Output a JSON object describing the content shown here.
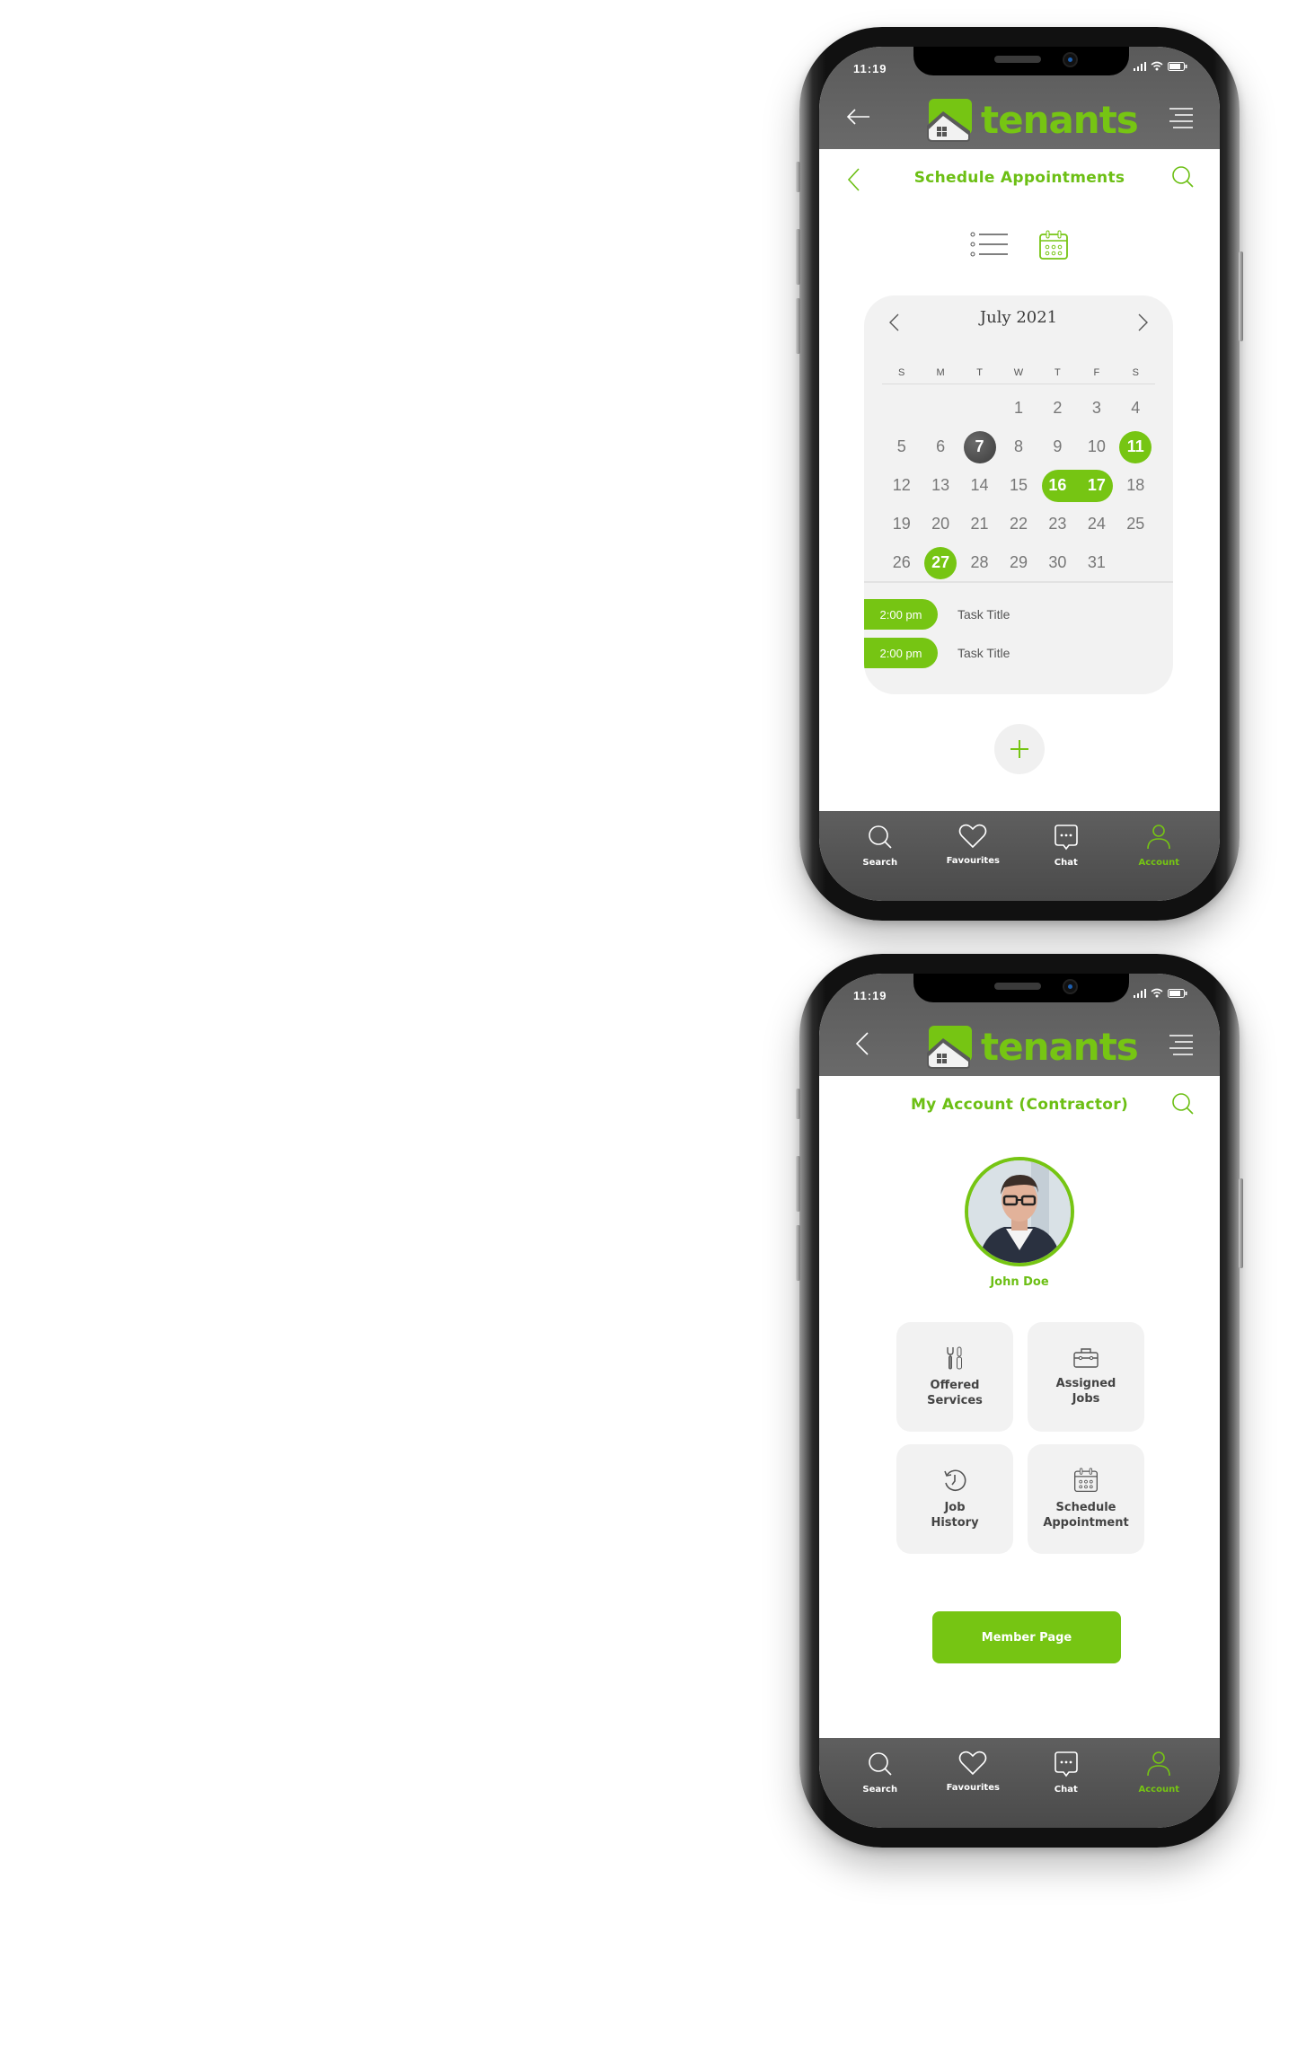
{
  "colors": {
    "accent": "#76c513",
    "header_bg": "#606060",
    "tabbar_bg": "#555555",
    "card_bg": "#f2f2f2",
    "today_bg": "#4a4a4a"
  },
  "brand": {
    "name": "tenants"
  },
  "status_bar": {
    "time": "11:19"
  },
  "tabs": [
    {
      "label": "Search",
      "icon": "search-icon"
    },
    {
      "label": "Favourites",
      "icon": "heart-icon"
    },
    {
      "label": "Chat",
      "icon": "chat-bubble-icon"
    },
    {
      "label": "Account",
      "icon": "user-icon",
      "active": true
    }
  ],
  "screen1": {
    "title": "Schedule Appointments",
    "view_modes": [
      {
        "name": "list-view",
        "active": false
      },
      {
        "name": "calendar-view",
        "active": true
      }
    ],
    "calendar": {
      "month_label": "July 2021",
      "weekdays": [
        "S",
        "M",
        "T",
        "W",
        "T",
        "F",
        "S"
      ],
      "leading_blanks": 3,
      "days_in_month": 31,
      "today": 7,
      "selected": [
        11,
        27
      ],
      "range": [
        16,
        17
      ]
    },
    "tasks": [
      {
        "time": "2:00 pm",
        "title": "Task Title"
      },
      {
        "time": "2:00 pm",
        "title": "Task Title"
      }
    ],
    "add_button": "+"
  },
  "screen2": {
    "title": "My Account (Contractor)",
    "user": {
      "name": "John Doe"
    },
    "tiles": [
      {
        "label": "Offered\nServices",
        "icon": "tools-icon"
      },
      {
        "label": "Assigned\nJobs",
        "icon": "toolbox-icon"
      },
      {
        "label": "Job\nHistory",
        "icon": "history-icon"
      },
      {
        "label": "Schedule\nAppointment",
        "icon": "calendar-icon"
      }
    ],
    "member_button": "Member Page"
  }
}
